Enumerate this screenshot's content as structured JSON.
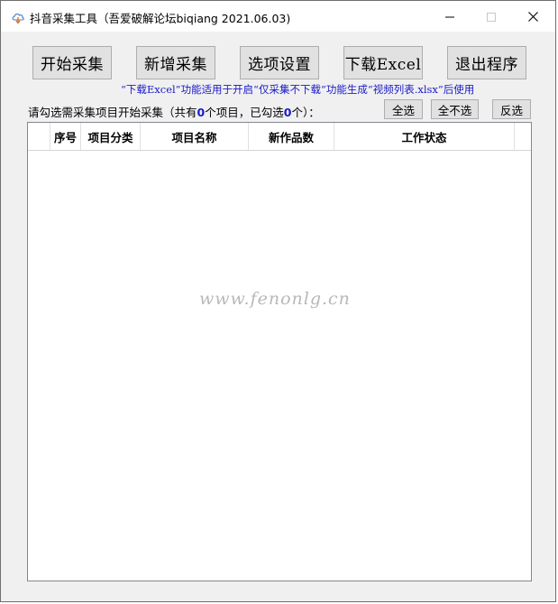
{
  "window": {
    "title": "抖音采集工具（吾爱破解论坛biqiang 2021.06.03)",
    "icons": {
      "app": "cloud-download-icon",
      "minimize": "minimize-icon",
      "maximize": "maximize-icon",
      "close": "close-icon"
    }
  },
  "toolbar": {
    "start_label": "开始采集",
    "add_label": "新增采集",
    "options_label": "选项设置",
    "download_label": "下载Excel",
    "exit_label": "退出程序"
  },
  "hint": "“下载Excel”功能适用于开启“仅采集不下载”功能生成“视频列表.xlsx”后使用",
  "selection": {
    "prefix": "请勾选需采集项目开始采集（共有",
    "total": "0",
    "middle": "个项目，已勾选",
    "checked": "0",
    "suffix": "个）：",
    "select_all_label": "全选",
    "select_none_label": "全不选",
    "invert_label": "反选"
  },
  "table": {
    "columns": [
      "",
      "序号",
      "项目分类",
      "项目名称",
      "新作品数",
      "工作状态"
    ],
    "rows": []
  },
  "watermark": "www.fenonlg.cn",
  "colors": {
    "hint_blue": "#1a1ac8",
    "window_bg": "#f0f0f0",
    "button_bg": "#e1e1e1"
  }
}
